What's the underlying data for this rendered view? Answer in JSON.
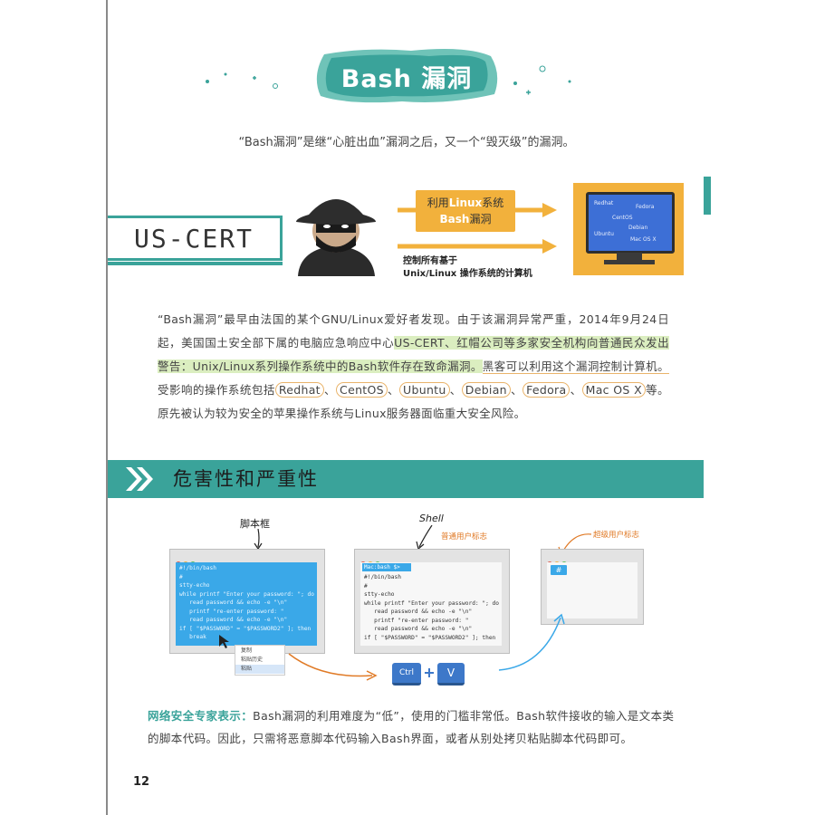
{
  "title": "Bash 漏洞",
  "intro": "“Bash漏洞”是继“心脏出血”漏洞之后，又一个“毁灭级”的漏洞。",
  "us_cert": "US-CERT",
  "arrow_box": {
    "line1_prefix": "利用",
    "line1_hl": "Linux",
    "line1_suffix": "系统",
    "line2_hl": "Bash",
    "line2_suffix": "漏洞"
  },
  "arrow_caption": {
    "line1": "控制所有基于",
    "line2": "Unix/Linux 操作系统的计算机"
  },
  "monitor_os": [
    "Redhat",
    "Fedora",
    "CentOS",
    "Debian",
    "Ubuntu",
    "Mac OS X"
  ],
  "paragraph": {
    "p1": "“Bash漏洞”最早由法国的某个GNU/Linux爱好者发现。由于该漏洞异常严重，2014年9月24日起，美国国土安全部下属的电脑应急响应中心",
    "g1": "US-CERT、红帽公司等多家安全机构向普通民众发出警告：Unix/Linux系列操作系统中的Bash软件存在致命漏洞。",
    "p2": "黑客可以利用这个漏洞控制计算机。",
    "p3": "受影响的操作系统包括",
    "os": [
      "Redhat",
      "CentOS",
      "Ubuntu",
      "Debian",
      "Fedora",
      "Mac OS X"
    ],
    "p4": "等。原先被认为较为安全的苹果操作系统与Linux服务器面临重大安全风险。"
  },
  "section_title": "危害性和严重性",
  "diagram": {
    "label_script": "脚本框",
    "label_shell": "Shell",
    "label_normal_user": "普通用户标志",
    "label_super_user": "超级用户标志",
    "script_code": "#!/bin/bash\n#\nstty-echo\nwhile printf \"Enter your password: \"; do\n   read password && echo -e \"\\n\"\n   printf \"re-enter password: \"\n   read password && echo -e \"\\n\"\nif [ \"$PASSWORD\" = \"$PASSWORD2\" ]; then\n   break",
    "shell_prompt": "Mac:bash $>",
    "shell_code": "#!/bin/bash\n#\nstty-echo\nwhile printf \"Enter your password: \"; do\n   read password && echo -e \"\\n\"\n   printf \"re-enter password: \"\n   read password && echo -e \"\\n\"\nif [ \"$PASSWORD\" = \"$PASSWORD2\" ]; then",
    "super_prompt": "#",
    "menu_items": [
      "复制",
      "粘贴历史",
      "粘贴"
    ],
    "key_ctrl": "Ctrl",
    "key_v": "V"
  },
  "bottom": {
    "lead": "网络安全专家表示：",
    "text": "Bash漏洞的利用难度为“低”，使用的门槛非常低。Bash软件接收的输入是文本类的脚本代码。因此，只需将恶意脚本代码输入Bash界面，或者从别处拷贝粘贴脚本代码即可。"
  },
  "page_number": "12",
  "colors": {
    "teal": "#3aa39a",
    "orange": "#f2b13c",
    "blue": "#3d78c9",
    "screen": "#3aa8e8"
  }
}
